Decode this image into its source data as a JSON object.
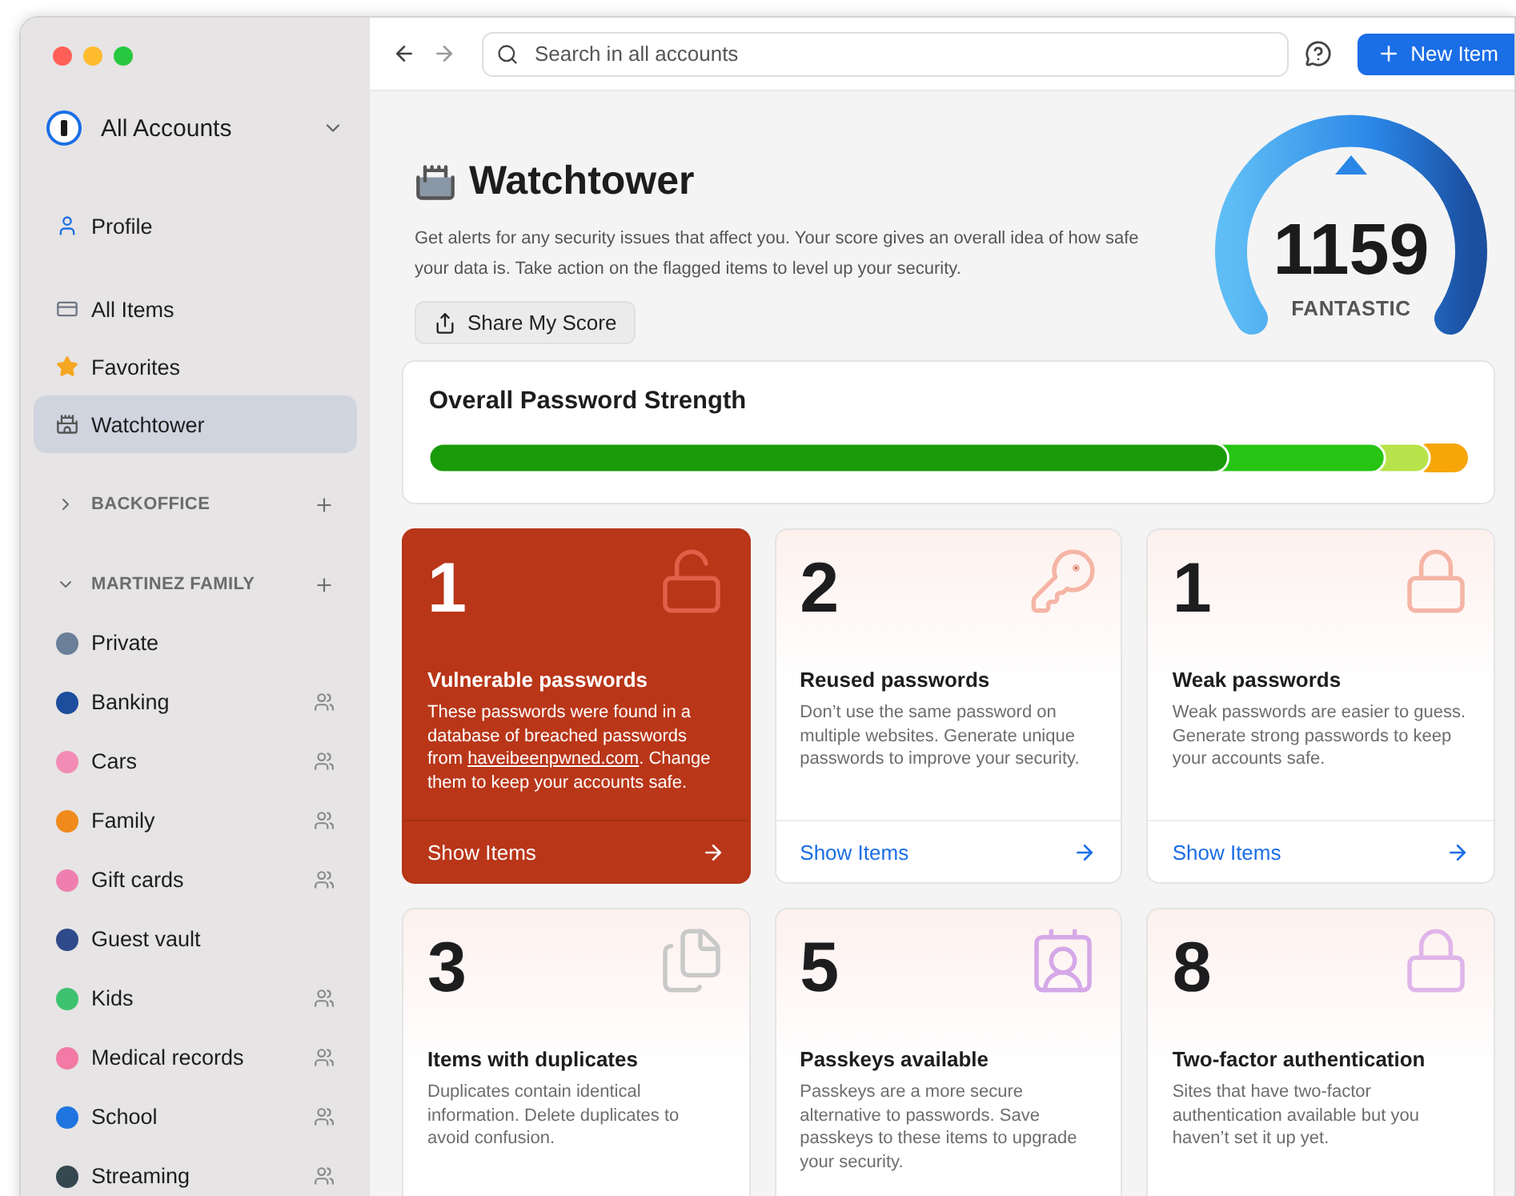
{
  "sidebar": {
    "account": {
      "label": "All Accounts"
    },
    "nav": [
      {
        "label": "Profile",
        "kind": "profile",
        "selected": false
      },
      {
        "label": "All Items",
        "kind": "items",
        "selected": false
      },
      {
        "label": "Favorites",
        "kind": "favorites",
        "selected": false
      },
      {
        "label": "Watchtower",
        "kind": "watchtower",
        "selected": true
      }
    ],
    "groups": [
      {
        "label": "BACKOFFICE",
        "expanded": false
      },
      {
        "label": "MARTINEZ FAMILY",
        "expanded": true,
        "vaults": [
          {
            "label": "Private",
            "color": "#6b7f99",
            "shared": false
          },
          {
            "label": "Banking",
            "color": "#1d4e9e",
            "shared": true
          },
          {
            "label": "Cars",
            "color": "#f28cb4",
            "shared": true
          },
          {
            "label": "Family",
            "color": "#f08a1c",
            "shared": true
          },
          {
            "label": "Gift cards",
            "color": "#ee7fb0",
            "shared": true
          },
          {
            "label": "Guest vault",
            "color": "#2f4a8a",
            "shared": false
          },
          {
            "label": "Kids",
            "color": "#3dc26f",
            "shared": true
          },
          {
            "label": "Medical records",
            "color": "#f27aa5",
            "shared": true
          },
          {
            "label": "School",
            "color": "#1f74e0",
            "shared": true
          },
          {
            "label": "Streaming",
            "color": "#35474f",
            "shared": true
          }
        ]
      }
    ]
  },
  "toolbar": {
    "search": {
      "placeholder": "Search in all accounts"
    },
    "new_button": "New Item"
  },
  "header": {
    "title": "Watchtower",
    "description": "Get alerts for any security issues that affect you. Your score gives an overall idea of how safe your data is. Take action on the flagged items to level up your security.",
    "share_button": "Share My Score",
    "score": "1159",
    "rating": "FANTASTIC"
  },
  "strength": {
    "title": "Overall Password Strength"
  },
  "cards": [
    {
      "kind": "vulnerable",
      "highlighted": true,
      "count": "1",
      "title": "Vulnerable passwords",
      "text_before": "These passwords were found in a database of breached passwords from ",
      "link": "haveibeenpwned.com",
      "text_after": ". Change them to keep your accounts safe.",
      "action": "Show Items"
    },
    {
      "kind": "reused",
      "highlighted": false,
      "count": "2",
      "title": "Reused passwords",
      "text_before": "Don’t use the same password on multiple websites. Generate unique passwords to improve your security.",
      "action": "Show Items"
    },
    {
      "kind": "weak",
      "highlighted": false,
      "count": "1",
      "title": "Weak passwords",
      "text_before": "Weak passwords are easier to guess. Generate strong passwords to keep your accounts safe.",
      "action": "Show Items"
    },
    {
      "kind": "duplicates",
      "highlighted": false,
      "count": "3",
      "title": "Items with duplicates",
      "text_before": "Duplicates contain identical information. Delete duplicates to avoid confusion."
    },
    {
      "kind": "passkeys",
      "highlighted": false,
      "count": "5",
      "title": "Passkeys available",
      "text_before": "Passkeys are a more secure alternative to passwords. Save passkeys to these items to upgrade your security."
    },
    {
      "kind": "twofactor",
      "highlighted": false,
      "count": "8",
      "title": "Two-factor authentication",
      "text_before": "Sites that have two-factor authentication available but you haven’t set it up yet."
    }
  ]
}
